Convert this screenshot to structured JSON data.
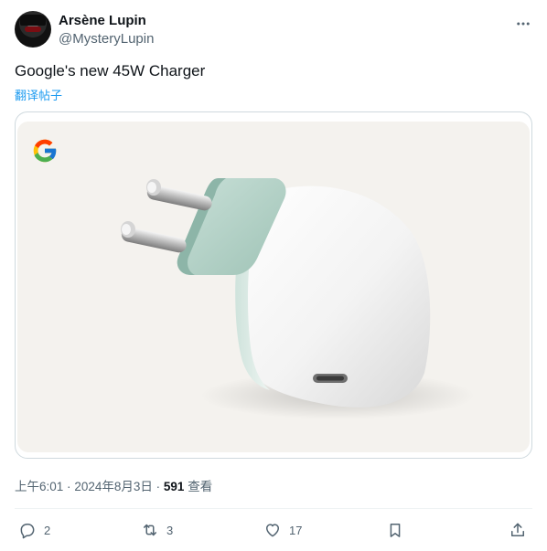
{
  "author": {
    "display_name": "Arsène Lupin",
    "handle": "@MysteryLupin"
  },
  "tweet": {
    "text": "Google's new 45W Charger",
    "translate_label": "翻译帖子"
  },
  "meta": {
    "time": "上午6:01",
    "separator": "·",
    "date": "2024年8月3日",
    "views_count": "591",
    "views_label": "查看"
  },
  "actions": {
    "replies": "2",
    "reposts": "3",
    "likes": "17"
  },
  "colors": {
    "accent": "#1d9bf0",
    "text_primary": "#0f1419",
    "text_secondary": "#536471",
    "border": "#cfd9de",
    "media_bg": "#f4f2ee"
  },
  "icons": [
    "more-icon",
    "google-logo-icon",
    "reply-icon",
    "repost-icon",
    "like-icon",
    "bookmark-icon",
    "share-icon"
  ]
}
